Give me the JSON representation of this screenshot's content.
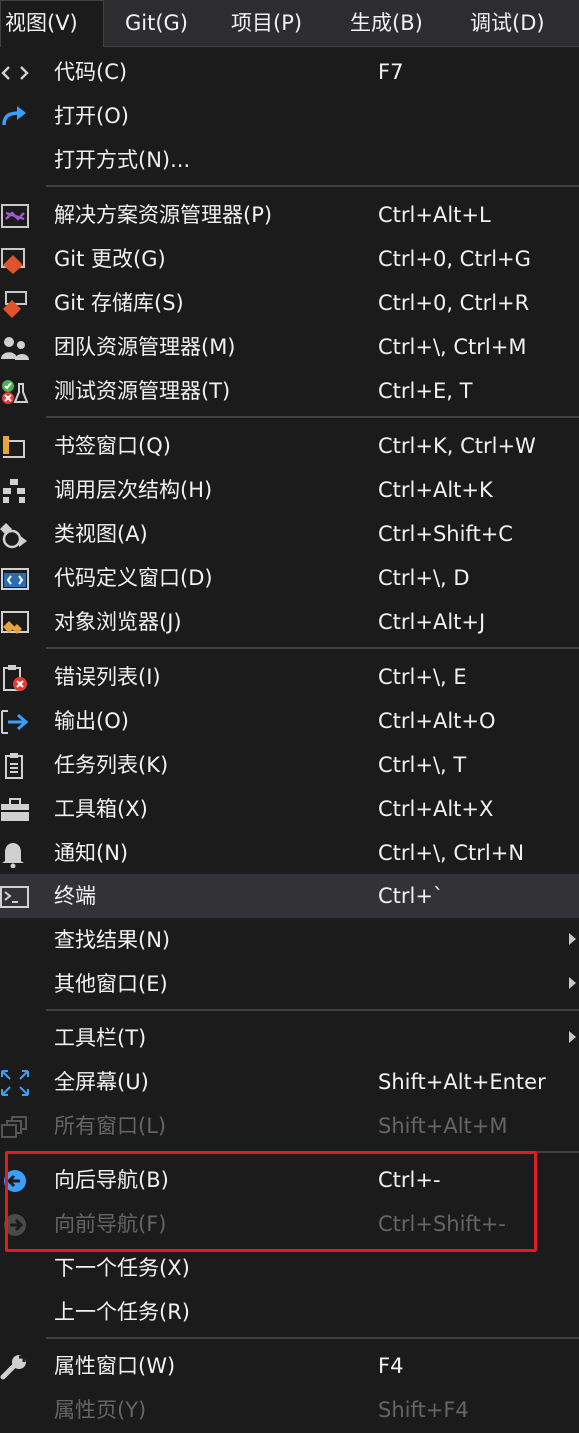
{
  "menubar": {
    "items": [
      {
        "label": "视图(V)",
        "active": true
      },
      {
        "label": "Git(G)"
      },
      {
        "label": "项目(P)"
      },
      {
        "label": "生成(B)"
      },
      {
        "label": "调试(D)"
      }
    ]
  },
  "menu": {
    "items": [
      {
        "icon": "code-brackets-icon",
        "label": "代码(C)",
        "shortcut": "F7"
      },
      {
        "icon": "open-arrow-icon",
        "label": "打开(O)",
        "shortcut": ""
      },
      {
        "icon": "",
        "label": "打开方式(N)...",
        "shortcut": ""
      },
      {
        "icon": "solution-explorer-icon",
        "label": "解决方案资源管理器(P)",
        "shortcut": "Ctrl+Alt+L"
      },
      {
        "icon": "git-changes-icon",
        "label": "Git 更改(G)",
        "shortcut": "Ctrl+0, Ctrl+G"
      },
      {
        "icon": "git-repository-icon",
        "label": "Git 存储库(S)",
        "shortcut": "Ctrl+0, Ctrl+R"
      },
      {
        "icon": "team-explorer-icon",
        "label": "团队资源管理器(M)",
        "shortcut": "Ctrl+\\, Ctrl+M"
      },
      {
        "icon": "test-explorer-icon",
        "label": "测试资源管理器(T)",
        "shortcut": "Ctrl+E, T"
      },
      {
        "icon": "bookmark-window-icon",
        "label": "书签窗口(Q)",
        "shortcut": "Ctrl+K, Ctrl+W"
      },
      {
        "icon": "call-hierarchy-icon",
        "label": "调用层次结构(H)",
        "shortcut": "Ctrl+Alt+K"
      },
      {
        "icon": "class-view-icon",
        "label": "类视图(A)",
        "shortcut": "Ctrl+Shift+C"
      },
      {
        "icon": "code-definition-icon",
        "label": "代码定义窗口(D)",
        "shortcut": "Ctrl+\\, D"
      },
      {
        "icon": "object-browser-icon",
        "label": "对象浏览器(J)",
        "shortcut": "Ctrl+Alt+J"
      },
      {
        "icon": "error-list-icon",
        "label": "错误列表(I)",
        "shortcut": "Ctrl+\\, E"
      },
      {
        "icon": "output-icon",
        "label": "输出(O)",
        "shortcut": "Ctrl+Alt+O"
      },
      {
        "icon": "task-list-icon",
        "label": "任务列表(K)",
        "shortcut": "Ctrl+\\, T"
      },
      {
        "icon": "toolbox-icon",
        "label": "工具箱(X)",
        "shortcut": "Ctrl+Alt+X"
      },
      {
        "icon": "bell-icon",
        "label": "通知(N)",
        "shortcut": "Ctrl+\\, Ctrl+N"
      },
      {
        "icon": "terminal-icon",
        "label": "终端",
        "shortcut": "Ctrl+`",
        "highlighted": true
      },
      {
        "icon": "",
        "label": "查找结果(N)",
        "shortcut": "",
        "submenu": true
      },
      {
        "icon": "",
        "label": "其他窗口(E)",
        "shortcut": "",
        "submenu": true
      },
      {
        "icon": "",
        "label": "工具栏(T)",
        "shortcut": "",
        "submenu": true
      },
      {
        "icon": "full-screen-icon",
        "label": "全屏幕(U)",
        "shortcut": "Shift+Alt+Enter"
      },
      {
        "icon": "all-windows-icon",
        "label": "所有窗口(L)",
        "shortcut": "Shift+Alt+M",
        "disabled": true
      },
      {
        "icon": "navigate-backward-icon",
        "label": "向后导航(B)",
        "shortcut": "Ctrl+-"
      },
      {
        "icon": "navigate-forward-icon",
        "label": "向前导航(F)",
        "shortcut": "Ctrl+Shift+-",
        "disabled": true
      },
      {
        "icon": "",
        "label": "下一个任务(X)",
        "shortcut": ""
      },
      {
        "icon": "",
        "label": "上一个任务(R)",
        "shortcut": ""
      },
      {
        "icon": "wrench-icon",
        "label": "属性窗口(W)",
        "shortcut": "F4"
      },
      {
        "icon": "",
        "label": "属性页(Y)",
        "shortcut": "Shift+F4",
        "disabled": true
      }
    ]
  },
  "colors": {
    "background": "#1b1b1c",
    "menubar": "#2d2d30",
    "highlight": "#333337",
    "separator": "#3f3f46",
    "disabled_text": "#656565",
    "annotation_box": "#e01b24"
  }
}
